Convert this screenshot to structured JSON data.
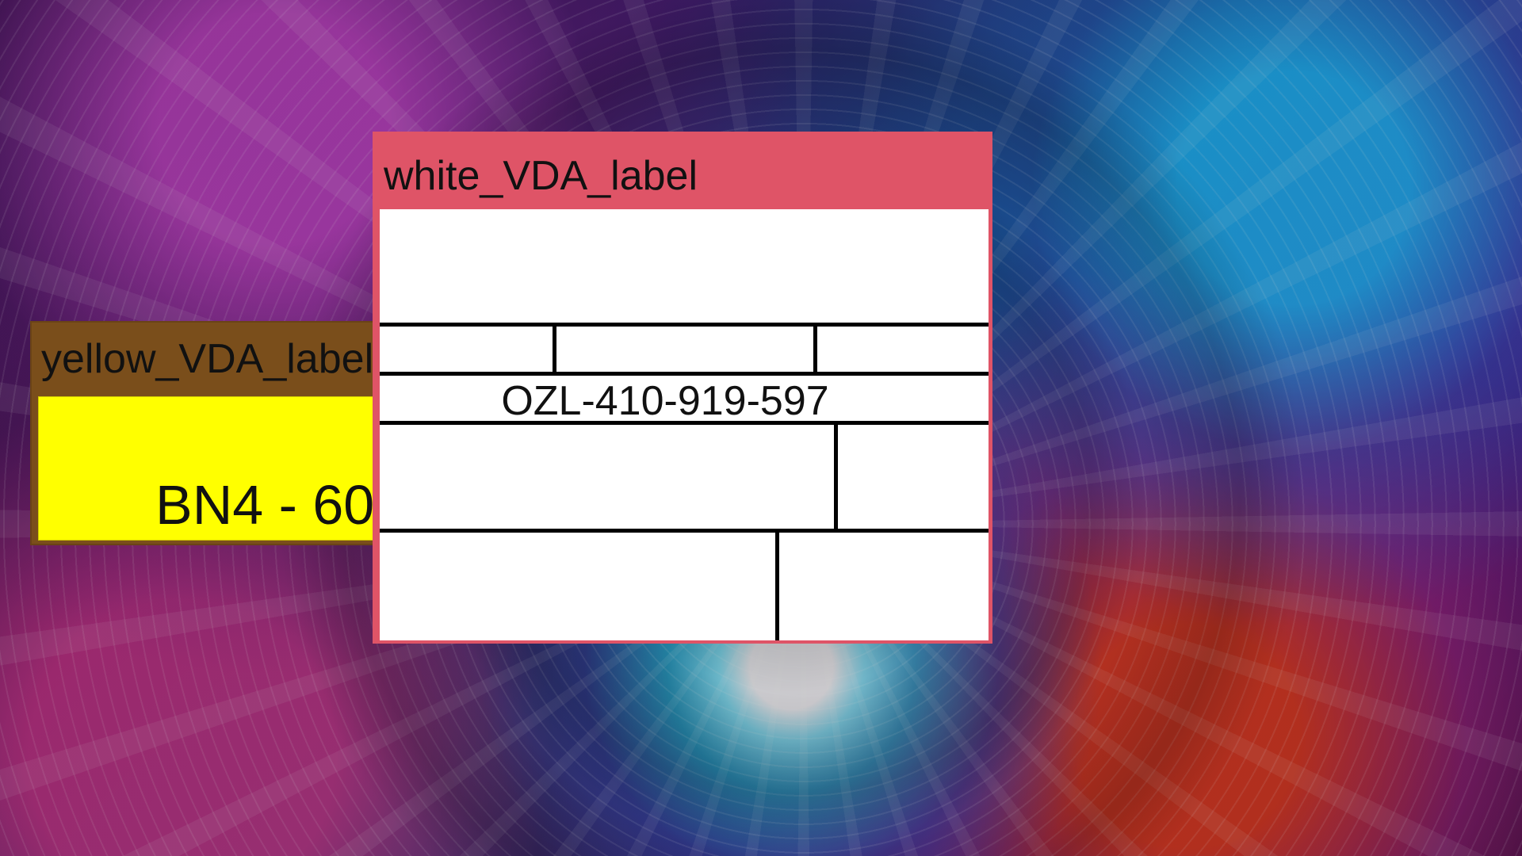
{
  "windows": {
    "yellow": {
      "title": "yellow_VDA_label",
      "value": "BN4 - 60"
    },
    "white": {
      "title": "white_VDA_label",
      "code": "OZL-410-919-597"
    }
  },
  "colors": {
    "yellow_window_bg": "#7a4e1b",
    "yellow_label_bg": "#ffff00",
    "white_window_bg": "#df5467",
    "white_label_bg": "#ffffff",
    "line": "#000000"
  }
}
